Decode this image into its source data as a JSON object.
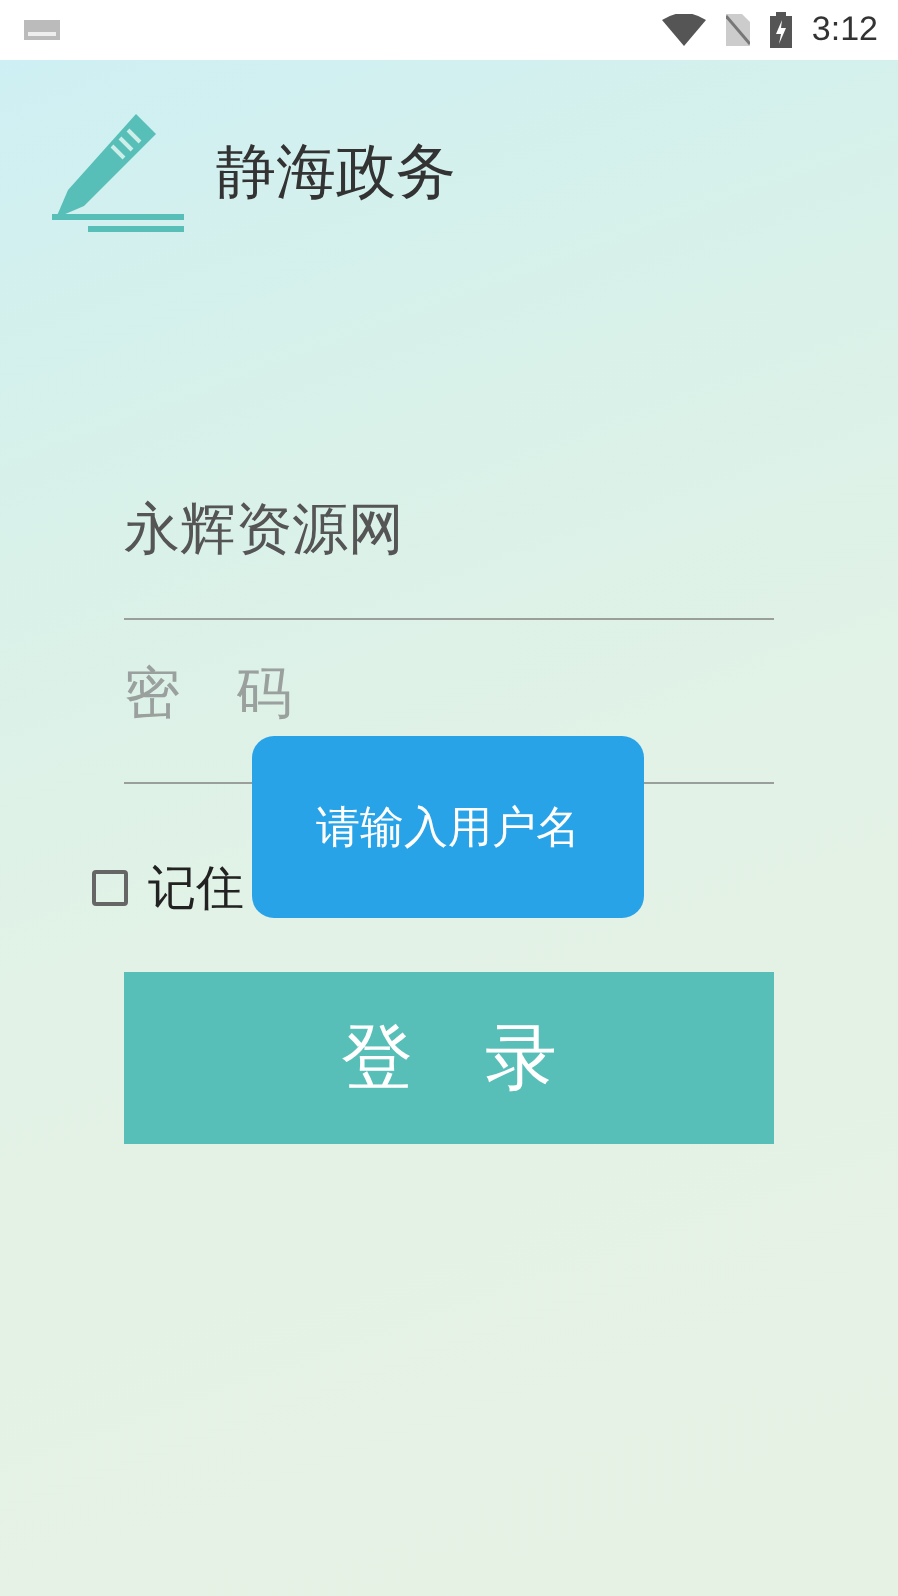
{
  "status_bar": {
    "time": "3:12"
  },
  "header": {
    "title": "静海政务"
  },
  "username": {
    "value": "永辉资源网"
  },
  "password": {
    "placeholder": "密　码"
  },
  "remember": {
    "label": "记住",
    "checked": false
  },
  "login_button": {
    "label": "登　录"
  },
  "toast": {
    "text": "请输入用户名"
  }
}
